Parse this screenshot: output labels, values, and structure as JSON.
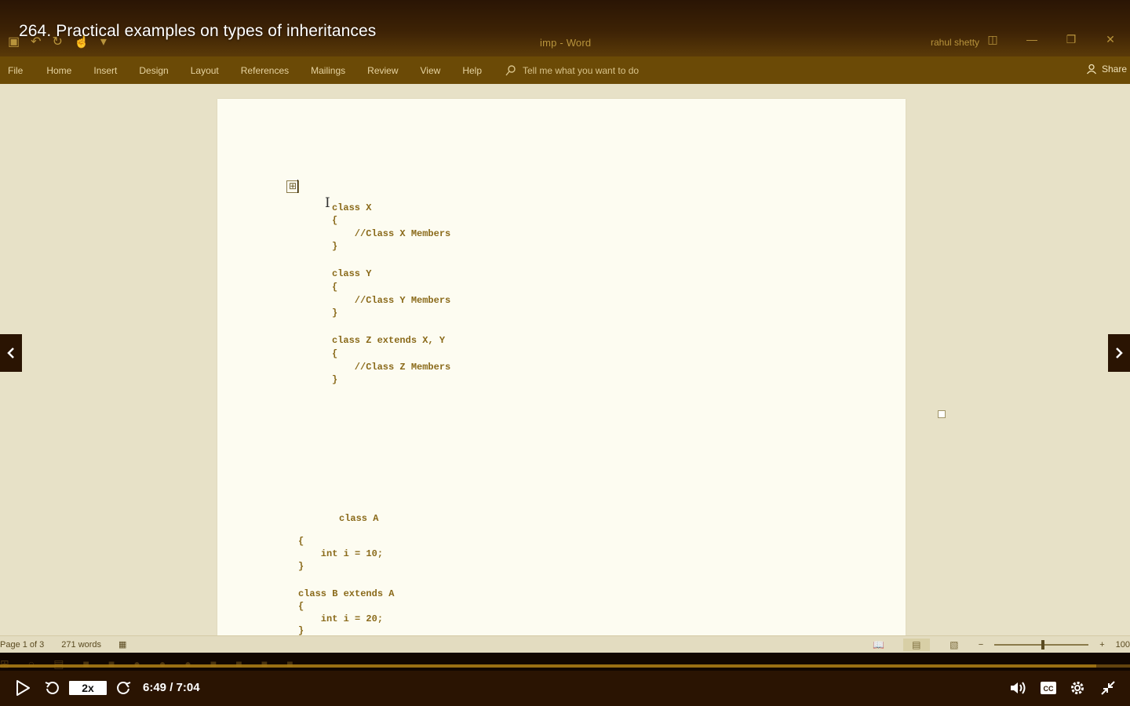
{
  "video": {
    "title": "264. Practical examples on types of inheritances",
    "speed": "2x",
    "time": "6:49 / 7:04",
    "progress": 0.97
  },
  "word": {
    "doc_title": "imp  -  Word",
    "user": "rahul shetty",
    "tabs": [
      "File",
      "Home",
      "Insert",
      "Design",
      "Layout",
      "References",
      "Mailings",
      "Review",
      "View",
      "Help"
    ],
    "tell_me_placeholder": "Tell me what you want to do",
    "share_label": "Share",
    "status": {
      "page": "Page 1 of 3",
      "words": "271 words",
      "zoom": "100"
    }
  },
  "document": {
    "block1": [
      "class X",
      "{",
      "    //Class X Members",
      "}",
      "",
      "class Y",
      "{",
      "    //Class Y Members",
      "}",
      "",
      "class Z extends X, Y",
      "{",
      "    //Class Z Members",
      "}"
    ],
    "block2_class_a": "class A",
    "block2_lines": [
      "{",
      "",
      "    int i = 10;",
      "}",
      "",
      "class B extends A",
      "{",
      "    int i = 20;",
      "}"
    ]
  },
  "colors": {
    "accent": "#a97b16",
    "ribbon": "#6b4a06",
    "code": "#8a6a1a"
  }
}
